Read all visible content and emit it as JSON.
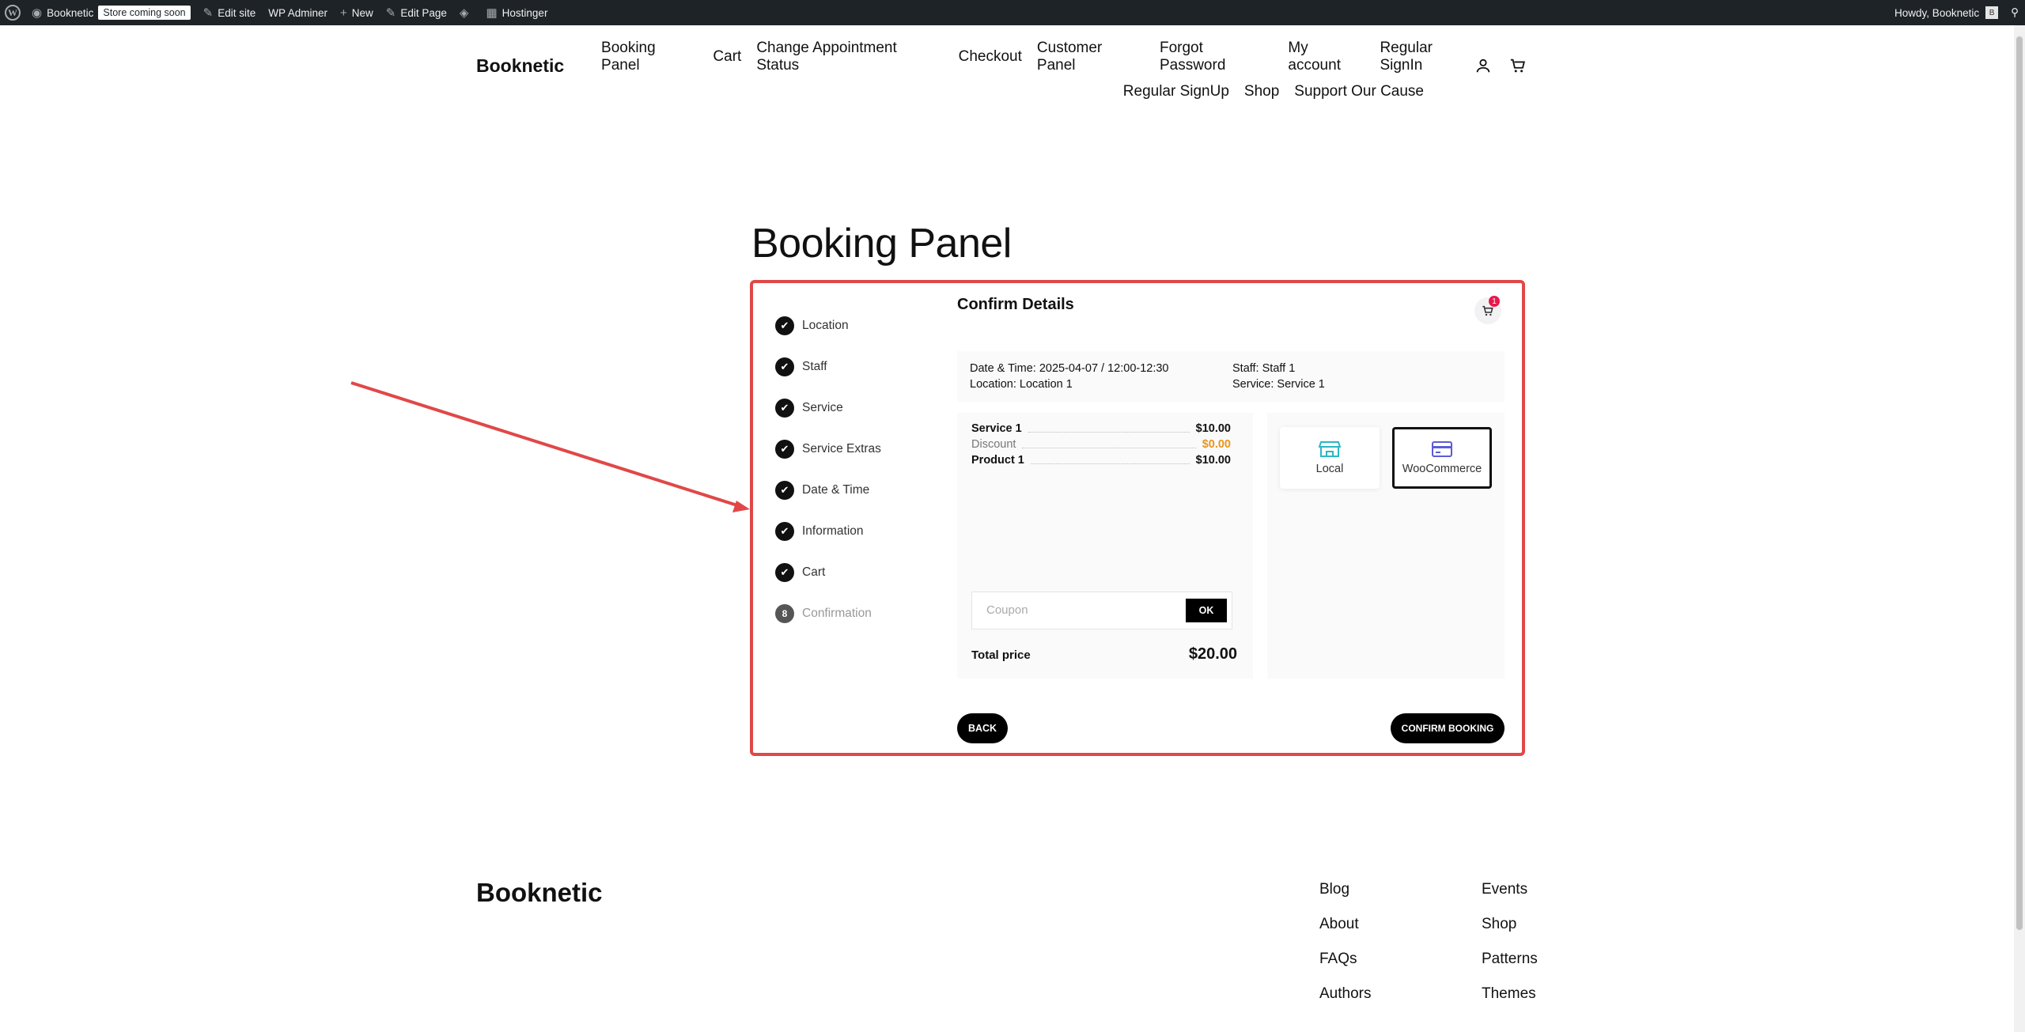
{
  "admin_bar": {
    "site_name": "Booknetic",
    "store_badge": "Store coming soon",
    "edit_site": "Edit site",
    "wp_adminer": "WP Adminer",
    "new": "New",
    "edit_page": "Edit Page",
    "hostinger": "Hostinger",
    "howdy": "Howdy, Booknetic",
    "avatar_initial": "B"
  },
  "header": {
    "site_title": "Booknetic",
    "nav_row1": [
      "Booking Panel",
      "Cart",
      "Change Appointment Status",
      "Checkout",
      "Customer Panel",
      "Forgot Password",
      "My account",
      "Regular SignIn"
    ],
    "nav_row2": [
      "Regular SignUp",
      "Shop",
      "Support Our Cause"
    ]
  },
  "page_title": "Booking Panel",
  "booking": {
    "steps": [
      {
        "label": "Location",
        "done": true
      },
      {
        "label": "Staff",
        "done": true
      },
      {
        "label": "Service",
        "done": true
      },
      {
        "label": "Service Extras",
        "done": true
      },
      {
        "label": "Date & Time",
        "done": true
      },
      {
        "label": "Information",
        "done": true
      },
      {
        "label": "Cart",
        "done": true
      },
      {
        "label": "Confirmation",
        "done": false,
        "number": "8"
      }
    ],
    "title": "Confirm Details",
    "cart_count": "1",
    "details": {
      "datetime": "Date & Time: 2025-04-07 / 12:00-12:30",
      "location": "Location: Location 1",
      "staff": "Staff: Staff 1",
      "service": "Service: Service 1"
    },
    "price_lines": [
      {
        "label": "Service 1",
        "value": "$10.00"
      },
      {
        "label": "Discount",
        "value": "$0.00"
      },
      {
        "label": "Product 1",
        "value": "$10.00"
      }
    ],
    "coupon_placeholder": "Coupon",
    "coupon_ok": "OK",
    "total_label": "Total price",
    "total_value": "$20.00",
    "payments": [
      {
        "label": "Local",
        "icon": "store-icon",
        "color": "#2bb8c4"
      },
      {
        "label": "WooCommerce",
        "icon": "credit-card-icon",
        "color": "#5b5bd6",
        "selected": true
      }
    ],
    "back_label": "BACK",
    "confirm_label": "CONFIRM BOOKING",
    "highlight_color": "#e04848"
  },
  "footer": {
    "title": "Booknetic",
    "col1": [
      "Blog",
      "About",
      "FAQs",
      "Authors"
    ],
    "col2": [
      "Events",
      "Shop",
      "Patterns",
      "Themes"
    ]
  }
}
